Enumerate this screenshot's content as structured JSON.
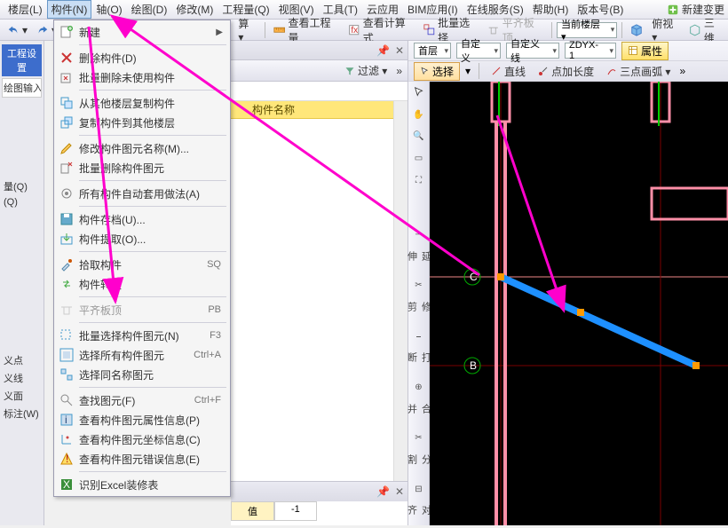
{
  "menubar": {
    "items": [
      {
        "label": "楼层(L)"
      },
      {
        "label": "构件(N)"
      },
      {
        "label": "轴(O)"
      },
      {
        "label": "绘图(D)"
      },
      {
        "label": "修改(M)"
      },
      {
        "label": "工程量(Q)"
      },
      {
        "label": "视图(V)"
      },
      {
        "label": "工具(T)"
      },
      {
        "label": "云应用"
      },
      {
        "label": "BIM应用(I)"
      },
      {
        "label": "在线服务(S)"
      },
      {
        "label": "帮助(H)"
      },
      {
        "label": "版本号(B)"
      }
    ],
    "right_btn": "新建变更"
  },
  "toolbar1": {
    "btn0": "算 ▾",
    "btn1": "查看工程量",
    "btn2": "查看计算式",
    "btn3": "批量选择",
    "btn4": "平齐板顶",
    "floor_label": "当前楼层 ▾",
    "view1": "俯视 ▾",
    "view2": "三维"
  },
  "left": {
    "hdr": "工程设置",
    "rows": [
      "绘图输入",
      "",
      "",
      "",
      "",
      "量(Q)",
      "(Q)",
      "",
      "",
      "",
      "义点",
      "义线",
      "义面",
      "标注(W)"
    ]
  },
  "cm": {
    "new": "新建",
    "del": "删除构件(D)",
    "batch_del": "批量删除未使用构件",
    "copy_from": "从其他楼层复制构件",
    "copy_to": "复制构件到其他楼层",
    "rename": "修改构件图元名称(M)...",
    "batch_del_el": "批量删除构件图元",
    "auto_apply": "所有构件自动套用做法(A)",
    "save": "构件存档(U)...",
    "extract": "构件提取(O)...",
    "pick": "拾取构件",
    "pick_sc": "SQ",
    "convert": "构件转换",
    "level": "平齐板顶",
    "level_sc": "PB",
    "batch_sel": "批量选择构件图元(N)",
    "batch_sel_sc": "F3",
    "sel_all": "选择所有构件图元",
    "sel_all_sc": "Ctrl+A",
    "sel_same": "选择同名称图元",
    "find": "查找图元(F)",
    "find_sc": "Ctrl+F",
    "prop": "查看构件图元属性信息(P)",
    "coord": "查看构件图元坐标信息(C)",
    "error": "查看构件图元错误信息(E)",
    "excel": "识别Excel装修表"
  },
  "mid": {
    "filter": "过滤 ▾",
    "col_name": "构件名称",
    "bot_tab1": "值",
    "bot_tab2": "-1"
  },
  "canvas_top": {
    "floor": "首层",
    "custom": "自定义",
    "custline": "自定义线",
    "zdyx": "ZDYX-1",
    "prop_btn": "属性",
    "select": "选择",
    "line": "直线",
    "ptlen": "点加长度",
    "arc": "三点画弧 ▾"
  },
  "vtool": {
    "labels": [
      "延伸",
      "修剪",
      "打断",
      "合并",
      "分割",
      "对齐"
    ]
  },
  "markers": {
    "B": "B",
    "C": "C"
  }
}
